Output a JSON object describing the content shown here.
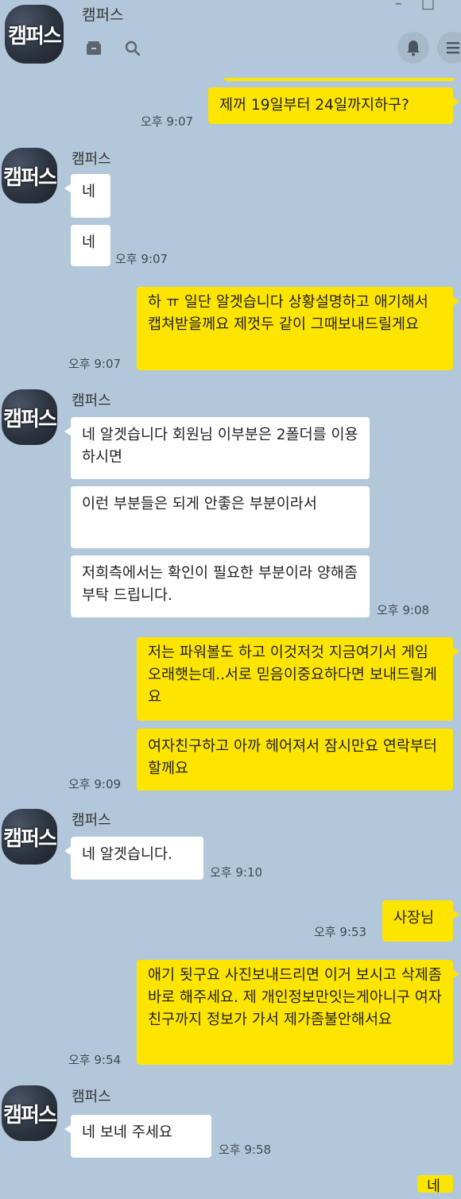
{
  "header": {
    "title": "캠퍼스",
    "avatar_text": "캠퍼스",
    "icons": [
      "folder-icon",
      "search-icon",
      "bell-icon",
      "menu-icon"
    ],
    "window_controls": [
      "–",
      "□"
    ]
  },
  "colors": {
    "background": "#b2c7d9",
    "my_bubble": "#fee500",
    "their_bubble": "#ffffff"
  },
  "messages": [
    {
      "from": "me",
      "text": "제꺼 19일부터 24일까지하구?",
      "time": "오후 9:07"
    },
    {
      "from": "them",
      "sender": "캠퍼스",
      "text": "네"
    },
    {
      "from": "them",
      "text": "네",
      "time": "오후 9:07"
    },
    {
      "from": "me",
      "text": "하 ㅠ 일단 알겟습니다 상황설명하고 애기해서 캡쳐받을께요 제껏두 같이 그때보내드릴게요",
      "time": "오후 9:07"
    },
    {
      "from": "them",
      "sender": "캠퍼스",
      "text": "네 알겟습니다 회원님 이부분은 2폴더를 이용하시면"
    },
    {
      "from": "them",
      "text": "이런 부분들은 되게 안좋은 부분이라서"
    },
    {
      "from": "them",
      "text": "저희측에서는 확인이 필요한 부분이라 양해좀 부탁 드립니다.",
      "time": "오후 9:08"
    },
    {
      "from": "me",
      "text": "저는 파워볼도 하고 이것저것 지금여기서 게임 오래햇는데..서로 믿음이중요하다면 보내드릴게요"
    },
    {
      "from": "me",
      "text": "여자친구하고 아까 헤어져서 잠시만요 연락부터할께요",
      "time": "오후 9:09"
    },
    {
      "from": "them",
      "sender": "캠퍼스",
      "text": "네 알겟습니다.",
      "time": "오후 9:10"
    },
    {
      "from": "me",
      "text": "사장님",
      "time": "오후 9:53"
    },
    {
      "from": "me",
      "text": "애기 됫구요 사진보내드리면 이거 보시고 삭제좀 바로 해주세요. 제 개인정보만잇는게아니구 여자친구까지 정보가 가서 제가좀불안해서요",
      "time": "오후 9:54"
    },
    {
      "from": "them",
      "sender": "캠퍼스",
      "text": "네 보네 주세요",
      "time": "오후 9:58"
    },
    {
      "from": "me",
      "text": "네"
    }
  ]
}
